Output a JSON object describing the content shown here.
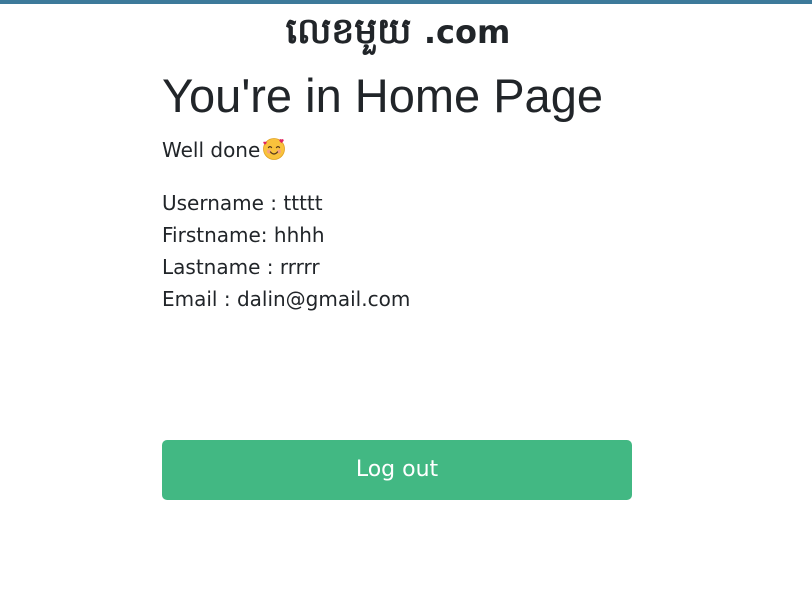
{
  "brand": {
    "khmer_text": "លេខមួយ",
    "suffix": ".com"
  },
  "page": {
    "title": "You're in Home Page",
    "subtitle": "Well done",
    "subtitle_emoji": "smiling-face-with-hearts-icon"
  },
  "user_info": {
    "username": "Username : ttttt",
    "firstname": "Firstname: hhhh",
    "lastname": "Lastname : rrrrr",
    "email": "Email : dalin@gmail.com"
  },
  "actions": {
    "logout_label": "Log out"
  },
  "colors": {
    "top_bar": "#3d7a9a",
    "logout_button": "#42b883",
    "text": "#212529"
  }
}
